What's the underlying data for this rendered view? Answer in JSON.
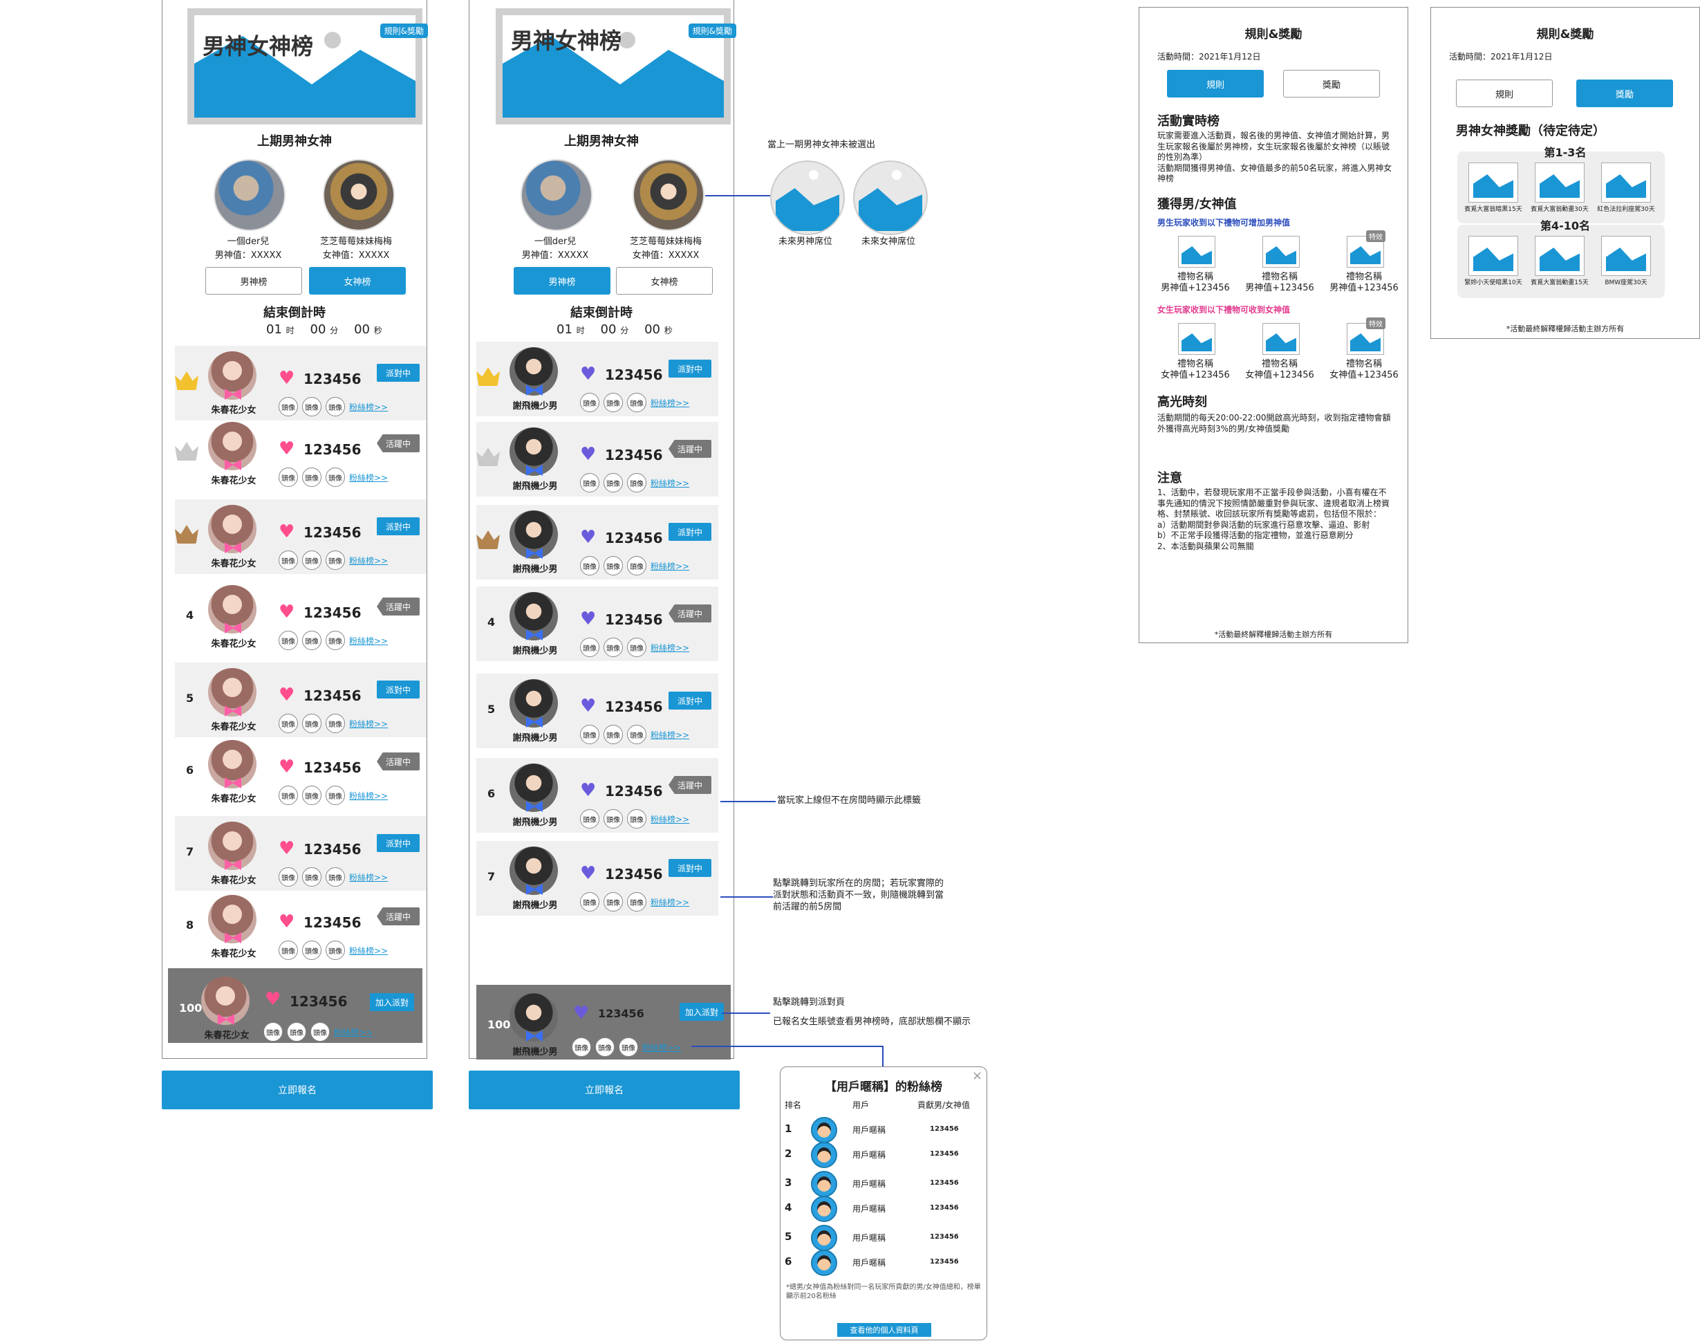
{
  "banner": {
    "title": "男神女神榜",
    "rules_btn": "規則&獎勵"
  },
  "last_period": {
    "title": "上期男神女神",
    "male": {
      "name": "一個der兒",
      "value": "男神值：XXXXX"
    },
    "female": {
      "name": "芝芝莓莓妹妹梅梅",
      "value": "女神值：XXXXX"
    }
  },
  "tabs": {
    "male": "男神榜",
    "female": "女神榜"
  },
  "countdown": {
    "title": "結束倒計時",
    "h": "01",
    "h_unit": "时",
    "m": "00",
    "m_unit": "分",
    "s": "00",
    "s_unit": "秒"
  },
  "list_left": [
    {
      "rank": "",
      "name": "朱春花少女",
      "score": "123456",
      "status": "派對中"
    },
    {
      "rank": "",
      "name": "朱春花少女",
      "score": "123456",
      "status": "活躍中"
    },
    {
      "rank": "",
      "name": "朱春花少女",
      "score": "123456",
      "status": "派對中"
    },
    {
      "rank": "4",
      "name": "朱春花少女",
      "score": "123456",
      "status": "活躍中"
    },
    {
      "rank": "5",
      "name": "朱春花少女",
      "score": "123456",
      "status": "派對中"
    },
    {
      "rank": "6",
      "name": "朱春花少女",
      "score": "123456",
      "status": "活躍中"
    },
    {
      "rank": "7",
      "name": "朱春花少女",
      "score": "123456",
      "status": "派對中"
    },
    {
      "rank": "8",
      "name": "朱春花少女",
      "score": "123456",
      "status": "活躍中"
    }
  ],
  "list_mid": [
    {
      "rank": "",
      "name": "謝飛機少男",
      "score": "123456",
      "status": "派對中"
    },
    {
      "rank": "",
      "name": "謝飛機少男",
      "score": "123456",
      "status": "活躍中"
    },
    {
      "rank": "",
      "name": "謝飛機少男",
      "score": "123456",
      "status": "派對中"
    },
    {
      "rank": "4",
      "name": "謝飛機少男",
      "score": "123456",
      "status": "活躍中"
    },
    {
      "rank": "5",
      "name": "謝飛機少男",
      "score": "123456",
      "status": "派對中"
    },
    {
      "rank": "6",
      "name": "謝飛機少男",
      "score": "123456",
      "status": "活躍中"
    },
    {
      "rank": "7",
      "name": "謝飛機少男",
      "score": "123456",
      "status": "派對中"
    }
  ],
  "fan_slot": "頭像",
  "fan_link": "粉絲榜>>",
  "self_left": {
    "rank": "100+",
    "name": "朱春花少女",
    "score": "123456",
    "btn": "加入派對"
  },
  "self_mid": {
    "rank": "100+",
    "name": "謝飛機少男",
    "score": "123456",
    "btn": "加入派對"
  },
  "signup": "立即報名",
  "annotations": {
    "not_selected": "當上一期男神女神未被選出",
    "future_male": "未來男神席位",
    "future_female": "未來女神席位",
    "active_tag": "當玩家上線但不在房間時顯示此標籤",
    "party_jump": "點擊跳轉到玩家所在的房間；若玩家實際的派對狀態和活動頁不一致，則隨機跳轉到當前活躍的前5房間",
    "join_party": "點擊跳轉到派對頁",
    "female_view": "已報名女生賬號查看男神榜時，底部狀態欄不顯示"
  },
  "fan_popup": {
    "title": "【用戶暱稱】的粉絲榜",
    "col_rank": "排名",
    "col_user": "用戶",
    "col_value": "貢獻男/女神值",
    "rows": [
      {
        "rank": "1",
        "user": "用戶暱稱",
        "value": "123456"
      },
      {
        "rank": "2",
        "user": "用戶暱稱",
        "value": "123456"
      },
      {
        "rank": "3",
        "user": "用戶暱稱",
        "value": "123456"
      },
      {
        "rank": "4",
        "user": "用戶暱稱",
        "value": "123456"
      },
      {
        "rank": "5",
        "user": "用戶暱稱",
        "value": "123456"
      },
      {
        "rank": "6",
        "user": "用戶暱稱",
        "value": "123456"
      }
    ],
    "footnote": "*總男/女神值為粉絲對同一名玩家所貢獻的男/女神值總和，榜單顯示前20名粉絲",
    "profile_btn": "查看他的個人資料頁"
  },
  "rules_panel": {
    "title": "規則&獎勵",
    "time": "活動時間：2021年1月12日",
    "tab_rules": "規則",
    "tab_rewards": "獎勵",
    "h1": "活動實時榜",
    "p1": "玩家需要進入活動頁，報名後的男神值、女神值才開始計算，男生玩家報名後屬於男神榜，女生玩家報名後屬於女神榜（以賬號的性別為準）\n活動期間獲得男神值、女神值最多的前50名玩家，將進入男神女神榜",
    "h2": "獲得男/女神值",
    "male_gift_title": "男生玩家收到以下禮物可增加男神值",
    "female_gift_title": "女生玩家收到以下禮物可收到女神值",
    "gift_name": "禮物名稱",
    "male_gift_val": "男神值+123456",
    "female_gift_val": "女神值+123456",
    "special": "特效",
    "h3": "高光時刻",
    "p3": "活動期間的每天20:00-22:00開啟高光時刻，收到指定禮物會額外獲得高光時刻3%的男/女神值獎勵",
    "h4": "注意",
    "p4": "1、活動中，若發現玩家用不正當手段參與活動，小喜有權在不事先通知的情況下按照情節嚴重對參與玩家、違規者取消上榜資格、封禁賬號、收回該玩家所有獎勵等處罰，包括但不限於：\na）活動期間對參與活動的玩家進行惡意攻擊、逼迫、影射\nb）不正常手段獲得活動的指定禮物，並進行惡意刷分\n2、本活動與蘋果公司無關",
    "footer": "*活動最終解釋權歸活動主辦方所有"
  },
  "rewards_panel": {
    "title": "規則&獎勵",
    "time": "活動時間：2021年1月12日",
    "tab_rules": "規則",
    "tab_rewards": "獎勵",
    "heading": "男神女神獎勵（待定待定）",
    "group1": "第1-3名",
    "group1_items": [
      "賓覓大富翁暗黑15天",
      "賓覓大富翁動畫30天",
      "紅色法拉利座駕30天"
    ],
    "group2": "第4-10名",
    "group2_items": [
      "緊妳小天使暗黑10天",
      "賓覓大富翁動畫15天",
      "BMW座駕30天"
    ],
    "footer": "*活動最終解釋權歸活動主辦方所有"
  },
  "colors": {
    "accent": "#1a96d4",
    "pink": "#ff4d8d",
    "purple": "#6a5bdc",
    "status_grey": "#777777"
  }
}
